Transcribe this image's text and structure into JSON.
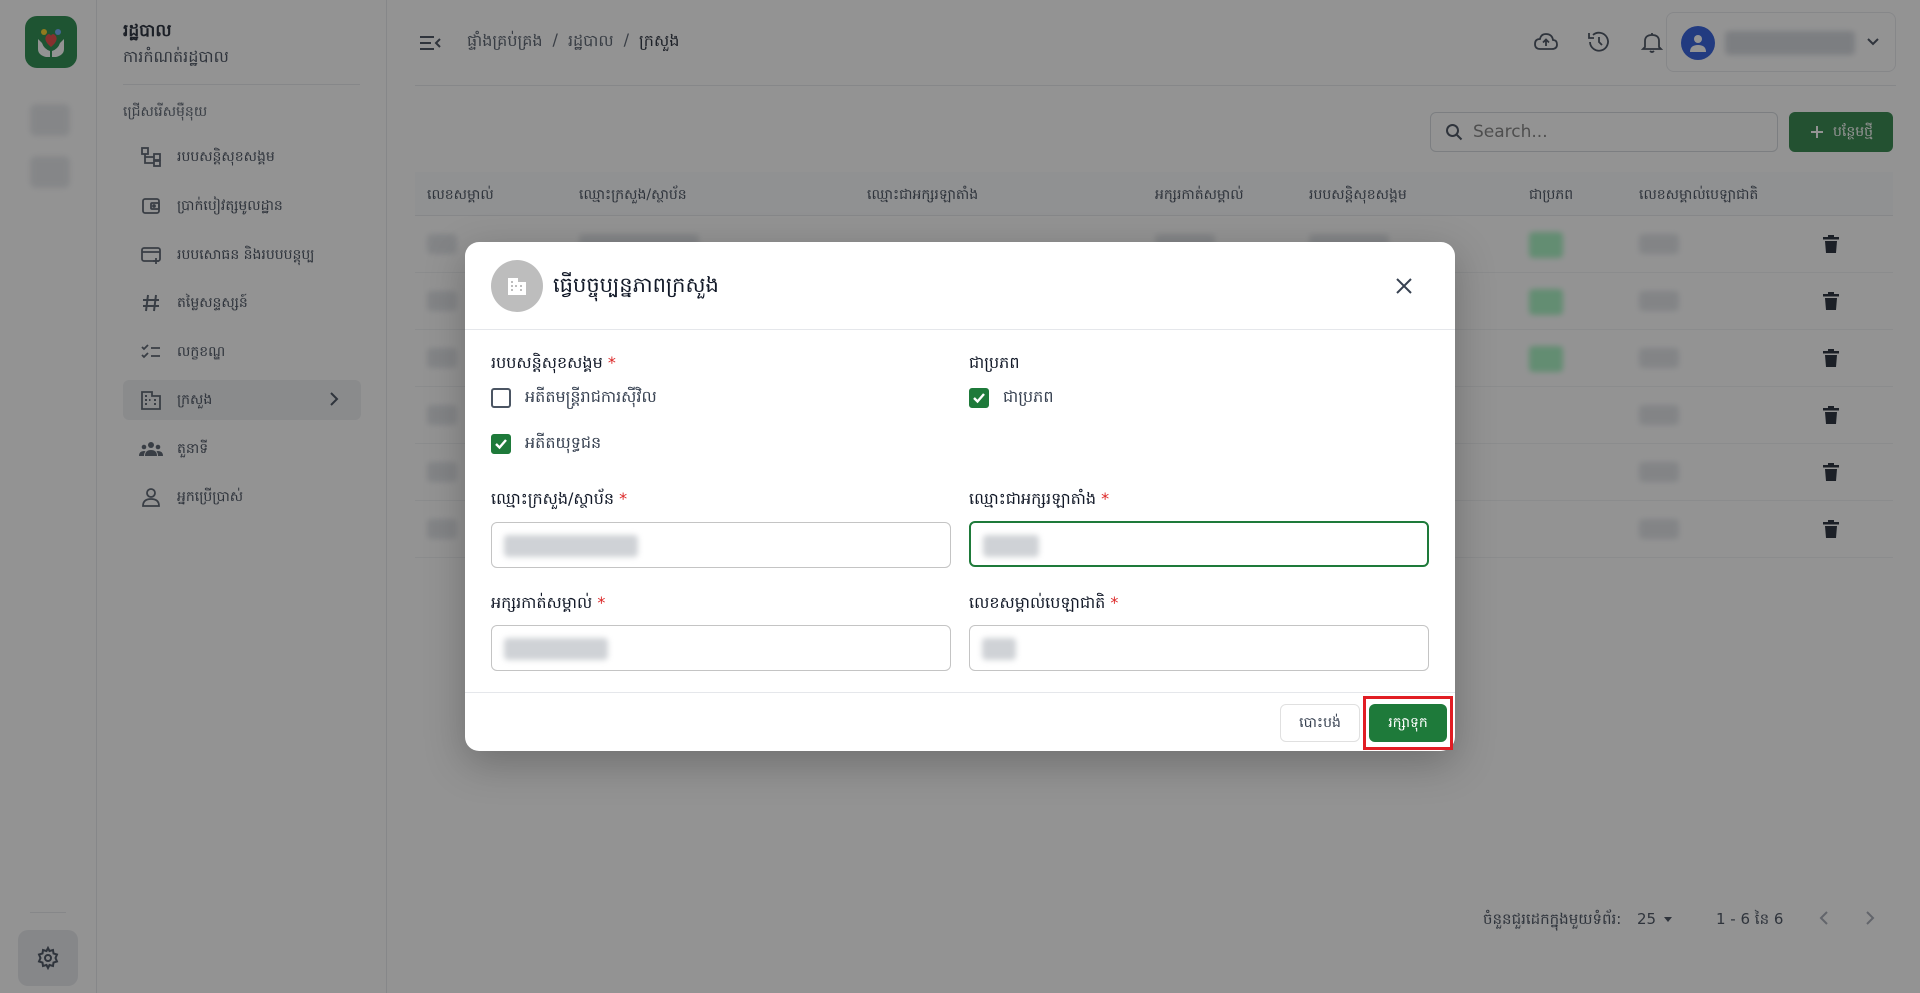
{
  "sidebar": {
    "title": "រដ្ឋបាល",
    "subtitle": "ការកំណត់រដ្ឋបាល",
    "section_label": "ជ្រើសរើសម៉ឺនុយ",
    "items": [
      {
        "label": "របបសន្តិសុខសង្គម",
        "icon": "hierarchy-icon"
      },
      {
        "label": "ប្រាក់បៀវត្សមូលដ្ឋាន",
        "icon": "wallet-icon"
      },
      {
        "label": "របបសោធន និងរបបបន្តុប្ប",
        "icon": "card-add-icon"
      },
      {
        "label": "តម្លៃសន្ទស្សន៍",
        "icon": "hash-icon"
      },
      {
        "label": "លក្ខខណ្ឌ",
        "icon": "checklist-icon"
      },
      {
        "label": "ក្រសួង",
        "icon": "building-icon",
        "active": true
      },
      {
        "label": "តួនាទី",
        "icon": "group-icon"
      },
      {
        "label": "អ្នកប្រើប្រាស់",
        "icon": "user-icon"
      }
    ]
  },
  "header": {
    "breadcrumbs": [
      "ផ្ទាំងគ្រប់គ្រង",
      "រដ្ឋបាល",
      "ក្រសួង"
    ],
    "separator": "/"
  },
  "toolbar": {
    "search_placeholder": "Search...",
    "add_label": "បន្ថែមថ្មី"
  },
  "table": {
    "columns": [
      "លេខសម្គាល់",
      "ឈ្មោះក្រសួង/ស្ថាប័ន",
      "ឈ្មោះជាអក្សរឡាតាំង",
      "អក្សរកាត់សម្គាល់",
      "របបសន្តិសុខសង្គម",
      "ជាប្រភព",
      "លេខសម្គាល់បេឡាជាតិ"
    ],
    "row_count": 6
  },
  "pagination": {
    "rows_per_page_label": "ចំនួនជួរដេកក្នុងមួយទំព័រ:",
    "rows_per_page_value": "25",
    "range_text": "1 - 6 នៃ 6"
  },
  "modal": {
    "title": "ធ្វើបច្ចុប្បន្នភាពក្រសួង",
    "social_security_label": "របបសន្តិសុខសង្គម",
    "required_mark": "*",
    "options": [
      {
        "label": "អតីតមន្ត្រីរាជការស៊ីវិល",
        "checked": false
      },
      {
        "label": "អតីតយុទ្ធជន",
        "checked": true
      }
    ],
    "source_label": "ជាប្រភព",
    "source_option": {
      "label": "ជាប្រភព",
      "checked": true
    },
    "fields": {
      "ministry_name_label": "ឈ្មោះក្រសួង/ស្ថាប័ន",
      "latin_name_label": "ឈ្មោះជាអក្សរឡាតាំង",
      "abbreviation_label": "អក្សរកាត់សម្គាល់",
      "nssf_id_label": "លេខសម្គាល់បេឡាជាតិ"
    },
    "cancel_label": "បោះបង់",
    "save_label": "រក្សាទុក"
  },
  "colors": {
    "primary": "#1e7a3a",
    "highlight": "#e11d24",
    "required": "#dc2626"
  }
}
